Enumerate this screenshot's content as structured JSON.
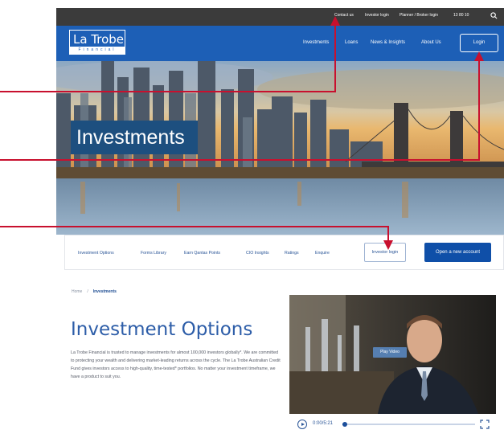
{
  "utility_bar": {
    "links": [
      "Contact us",
      "Investor login",
      "Planner / Broker login",
      "13 80 10"
    ],
    "search_icon": "search-icon"
  },
  "nav": {
    "logo_line1": "La Trobe",
    "logo_line2": "Financial",
    "links": [
      "Investments",
      "Loans",
      "News & Insights",
      "About Us"
    ],
    "login": "Login"
  },
  "hero": {
    "title": "Investments"
  },
  "sub_nav": {
    "links": [
      "Investment Options",
      "Forms Library",
      "Earn Qantas Points",
      "CIO Insights",
      "Ratings",
      "Enquire"
    ],
    "investor_login": "Investor login",
    "open_account": "Open a new account"
  },
  "breadcrumb": {
    "home": "Home",
    "separator": "/",
    "current": "Investments"
  },
  "page": {
    "title": "Investment Options",
    "body": "La Trobe Financial is trusted to manage investments for almost 100,000 investors globally*. We are committed to protecting your wealth and delivering market-leading returns across the cycle. The La Trobe Australian Credit Fund gives investors access to high-quality, time-tested* portfolios. No matter your investment timeframe, we have a product to suit you."
  },
  "video": {
    "play_label": "Play Video",
    "timecode": "0:00/5:21",
    "progress": 0.02
  },
  "colors": {
    "brand_blue": "#1d5fb6",
    "dark_bar": "#3b3b3b",
    "callout_red": "#c8102e"
  }
}
